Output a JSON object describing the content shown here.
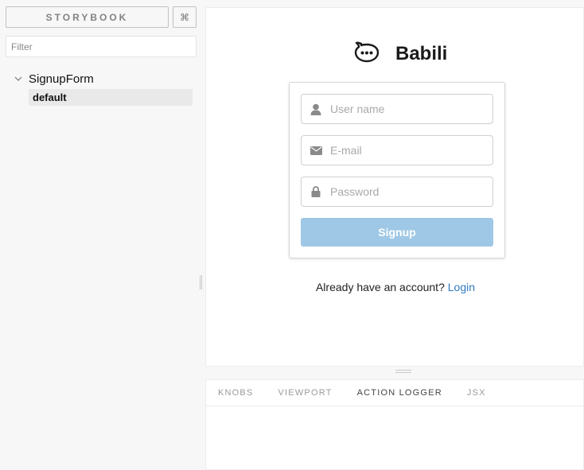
{
  "sidebar": {
    "brand": "STORYBOOK",
    "shortcut": "⌘",
    "filter_placeholder": "Filter",
    "kind": "SignupForm",
    "story": "default"
  },
  "preview": {
    "brand_name": "Babili",
    "username_placeholder": "User name",
    "email_placeholder": "E-mail",
    "password_placeholder": "Password",
    "signup_label": "Signup",
    "already_text": "Already have an account?",
    "login_link": "Login",
    "accent": "#2f7abf",
    "button_color": "#9fc8e6"
  },
  "addons": {
    "tabs": [
      "KNOBS",
      "VIEWPORT",
      "ACTION LOGGER",
      "JSX"
    ],
    "active_tab": "ACTION LOGGER"
  }
}
